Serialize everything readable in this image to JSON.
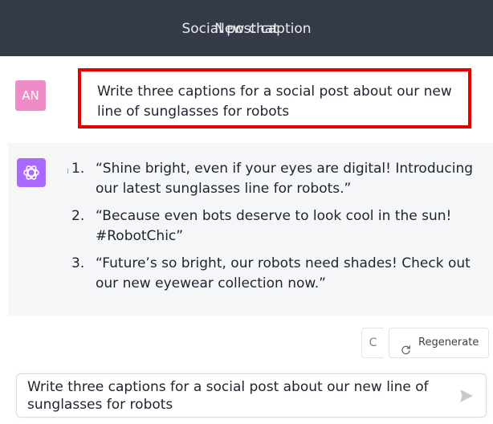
{
  "header": {
    "title_a": "Social post caption",
    "title_b": "New chat"
  },
  "user_message": {
    "avatar_initials": "AN",
    "text": "Write three captions for a social post about our new line of sunglasses for robots"
  },
  "assistant_message": {
    "items": [
      {
        "num": "1.",
        "text": "“Shine bright, even if your eyes are digital! Introducing our latest sunglasses line for robots.”"
      },
      {
        "num": "2.",
        "text": "“Because even bots deserve to look cool in the sun! #RobotChic”"
      },
      {
        "num": "3.",
        "text": "“Future’s so bright, our robots need shades! Check out our new eyewear collection now.”"
      }
    ]
  },
  "controls": {
    "stub_label": "C",
    "regenerate_label": "Regenerate"
  },
  "composer": {
    "value": "Write three captions for a social post about our new line of sunglasses for robots"
  },
  "colors": {
    "header_bg": "#343a48",
    "user_avatar": "#ee8cc8",
    "assistant_avatar": "#ab68ff",
    "highlight": "#e60000",
    "assistant_bg": "#f5f6f8"
  },
  "icons": {
    "assistant": "openai-logo-icon",
    "regenerate": "refresh-icon",
    "send": "send-arrow-icon"
  }
}
